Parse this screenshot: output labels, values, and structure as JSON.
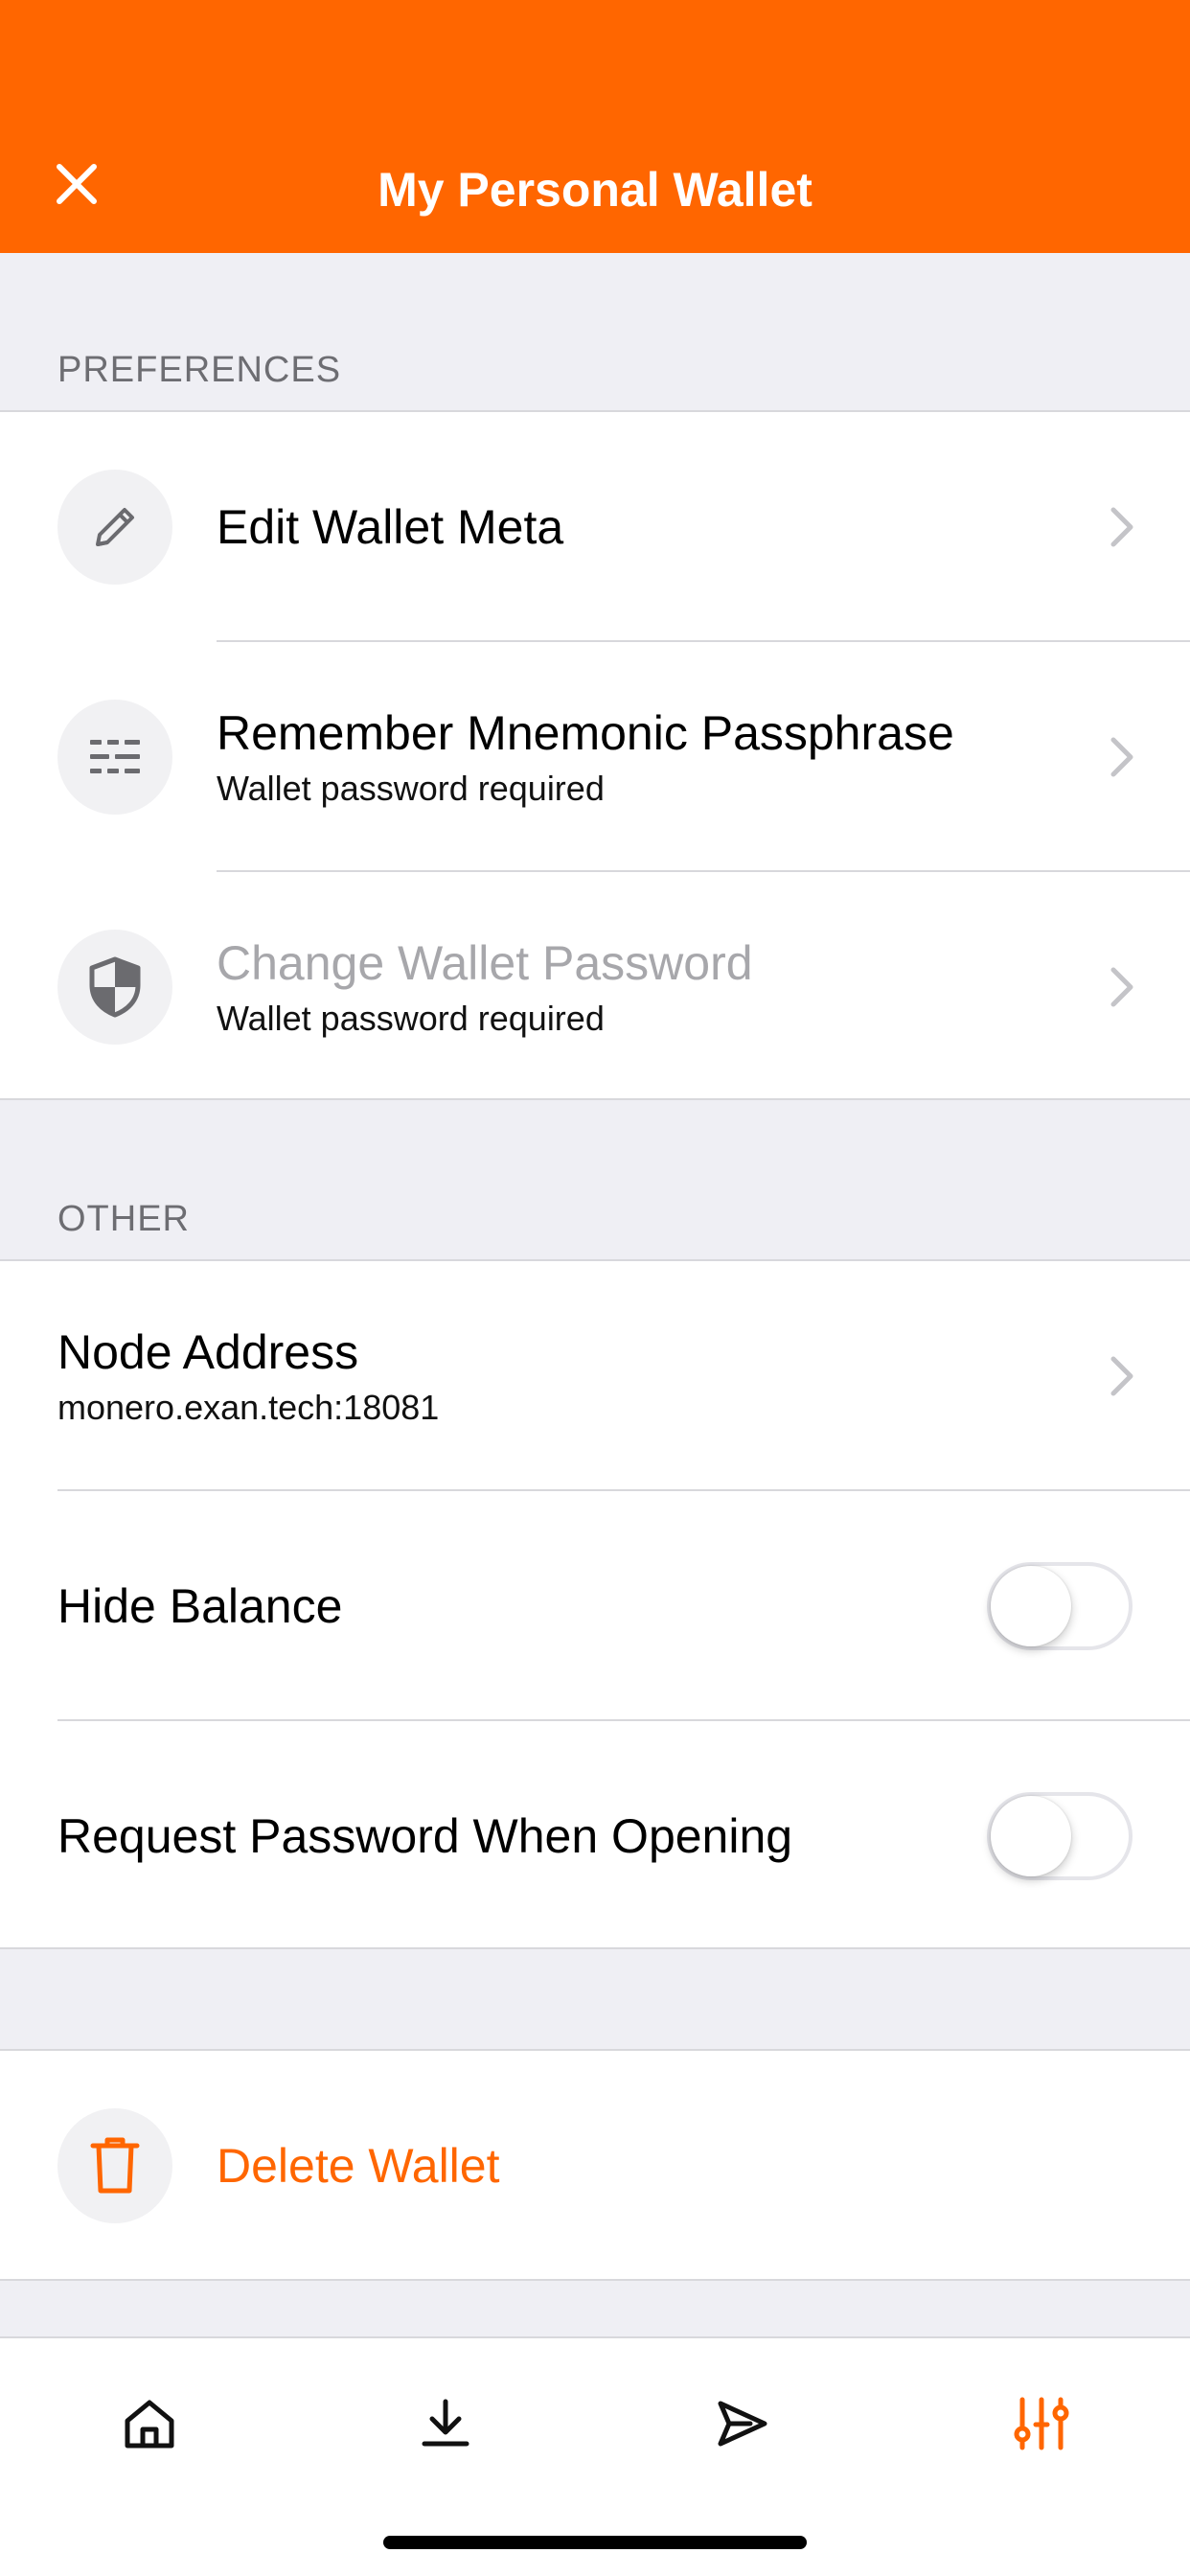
{
  "header": {
    "title": "My Personal Wallet",
    "close_icon": "close-icon"
  },
  "preferences": {
    "section_title": "PREFERENCES",
    "items": [
      {
        "label": "Edit Wallet Meta",
        "sublabel": "",
        "icon": "pencil-icon",
        "disabled": false
      },
      {
        "label": "Remember Mnemonic Passphrase",
        "sublabel": "Wallet password required",
        "icon": "mnemonic-icon",
        "disabled": false
      },
      {
        "label": "Change Wallet Password",
        "sublabel": "Wallet password required",
        "icon": "shield-icon",
        "disabled": true
      }
    ]
  },
  "other": {
    "section_title": "OTHER",
    "node": {
      "label": "Node Address",
      "value": "monero.exan.tech:18081"
    },
    "hide_balance": {
      "label": "Hide Balance",
      "enabled": false
    },
    "request_password": {
      "label": "Request Password When Opening",
      "enabled": false
    }
  },
  "danger": {
    "delete_label": "Delete Wallet",
    "icon": "trash-icon"
  },
  "tabbar": {
    "tabs": [
      {
        "name": "home",
        "icon": "home-icon",
        "active": false
      },
      {
        "name": "receive",
        "icon": "download-icon",
        "active": false
      },
      {
        "name": "send",
        "icon": "send-icon",
        "active": false
      },
      {
        "name": "settings",
        "icon": "sliders-icon",
        "active": true
      }
    ]
  },
  "colors": {
    "accent": "#ff6600",
    "background": "#efeff4",
    "disabled_text": "#a7a7ab",
    "section_text": "#6d6d72",
    "separator": "#d8d8dc"
  }
}
